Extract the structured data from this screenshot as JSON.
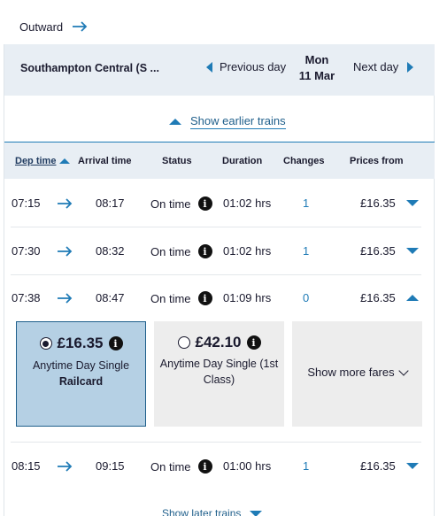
{
  "journey": {
    "direction_label": "Outward"
  },
  "station_bar": {
    "station": "Southampton Central (S ...",
    "prev_day": "Previous day",
    "day": "Mon",
    "date": "11 Mar",
    "next_day": "Next day"
  },
  "earlier_trains": "Show earlier trains",
  "later_trains": "Show later trains",
  "columns": {
    "dep": "Dep time",
    "arr": "Arrival time",
    "status": "Status",
    "duration": "Duration",
    "changes": "Changes",
    "price": "Prices from"
  },
  "trains": [
    {
      "dep": "07:15",
      "arr": "08:17",
      "status": "On time",
      "duration": "01:02 hrs",
      "changes": "1",
      "price": "£16.35",
      "expanded": false
    },
    {
      "dep": "07:30",
      "arr": "08:32",
      "status": "On time",
      "duration": "01:02 hrs",
      "changes": "1",
      "price": "£16.35",
      "expanded": false
    },
    {
      "dep": "07:38",
      "arr": "08:47",
      "status": "On time",
      "duration": "01:09 hrs",
      "changes": "0",
      "price": "£16.35",
      "expanded": true
    },
    {
      "dep": "08:15",
      "arr": "09:15",
      "status": "On time",
      "duration": "01:00 hrs",
      "changes": "1",
      "price": "£16.35",
      "expanded": false
    }
  ],
  "fares": [
    {
      "price": "£16.35",
      "name": "Anytime Day Single",
      "sub": "Railcard",
      "selected": true
    },
    {
      "price": "£42.10",
      "name": "Anytime Day Single (1st Class)",
      "selected": false
    }
  ],
  "show_more_fares": "Show more fares",
  "colors": {
    "accent": "#1f7bb6",
    "header_bg": "#e8eef4",
    "selected_fare_bg": "#b5d0e4"
  },
  "icons": {
    "arrow": "arrow-right-icon",
    "info": "info-icon",
    "expand": "triangle-down-icon",
    "collapse": "triangle-up-icon"
  }
}
